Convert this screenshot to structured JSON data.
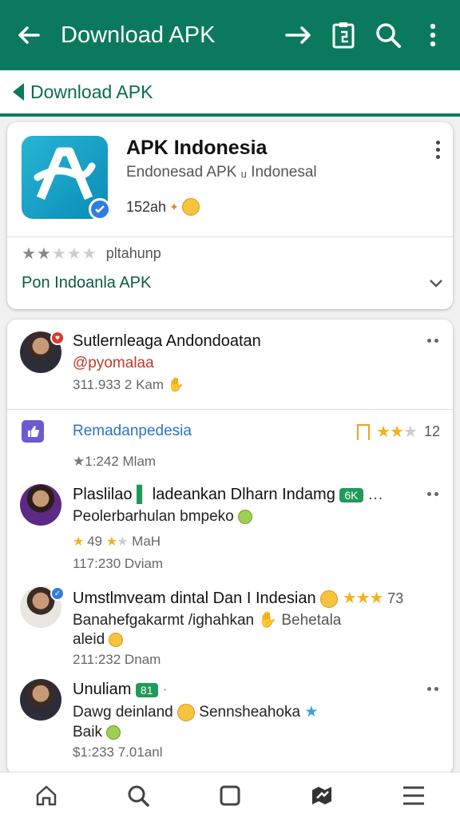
{
  "appbar": {
    "title": "Download APK",
    "back_icon": "arrow-left-icon",
    "forward_icon": "arrow-right-icon",
    "clipboard_icon": "clipboard-icon",
    "search_icon": "search-icon",
    "more_icon": "more-vertical-icon",
    "color": "#0b7a5c"
  },
  "breadcrumb": {
    "label": "Download APK"
  },
  "app": {
    "name": "APK Indonesia",
    "subtitle": "Endonesad APK ᵤ Indonesal",
    "size": "152ah",
    "rating_label": "pltahunp",
    "rating_stars": 2,
    "rating_max": 5,
    "dropdown_value": "Pon Indoanla APK"
  },
  "posts": [
    {
      "name": "Sutlernleaga Andondoatan",
      "handle": "@pyomalaa",
      "meta": "311.933 2 Kam"
    },
    {
      "name": "Remadanpedesia",
      "rating_count": "12",
      "meta": "1:242 Mlam"
    },
    {
      "name": "Plaslilao",
      "name_tail": "ladeankan Dlharn Indamg",
      "tag": "6K",
      "body": "Peolerbarhulan bmpeko",
      "rating_line": "49",
      "rating_tail": "MaH",
      "meta": "117:230 Dviam"
    },
    {
      "name": "Umstlmveam dintal Dan I Indesian",
      "rating_count": "73",
      "body": "Banahefgakarmt /ighahkan",
      "body_tail": "Behetala",
      "body2": "aleid",
      "meta": "211:232 Dnam"
    },
    {
      "name": "Unuliam",
      "tag": "81",
      "body": "Dawg deinland",
      "body_tail": "Sennsheahoka",
      "body2": "Baik",
      "meta": "$1:233 7.01anl"
    }
  ],
  "bottom_nav": {
    "items": [
      "home-icon",
      "search-icon",
      "square-icon",
      "maps-icon",
      "menu-icon"
    ]
  }
}
